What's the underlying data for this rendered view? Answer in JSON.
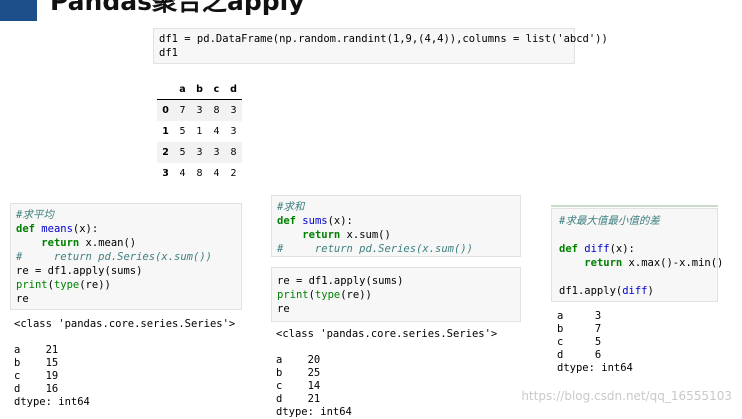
{
  "slide": {
    "title": "Pandas聚合之apply",
    "watermark": "https://blog.csdn.net/qq_16555103"
  },
  "top_cell": {
    "lines": [
      "df1 = pd.DataFrame(np.random.randint(1,9,(4,4)),columns = list('abcd'))",
      "df1"
    ]
  },
  "dataframe": {
    "columns": [
      "",
      "a",
      "b",
      "c",
      "d"
    ],
    "rows": [
      {
        "index": "0",
        "values": [
          "7",
          "3",
          "8",
          "3"
        ]
      },
      {
        "index": "1",
        "values": [
          "5",
          "1",
          "4",
          "3"
        ]
      },
      {
        "index": "2",
        "values": [
          "5",
          "3",
          "3",
          "8"
        ]
      },
      {
        "index": "3",
        "values": [
          "4",
          "8",
          "4",
          "2"
        ]
      }
    ]
  },
  "mean_cell": {
    "comment": "#求平均",
    "def_kw": "def",
    "func_name": "means",
    "def_rest": "(x):",
    "return_kw": "return",
    "return_rest": " x.mean()",
    "commented_line": "#     return pd.Series(x.sum())",
    "apply_line": "re = df1.apply(sums)",
    "print_kw": "print",
    "type_kw": "type",
    "print_rest_1": "(",
    "print_rest_2": "(re))",
    "last_line": "re",
    "output": [
      "<class 'pandas.core.series.Series'>",
      "",
      "a    21",
      "b    15",
      "c    19",
      "d    16",
      "dtype: int64"
    ]
  },
  "sum_cell": {
    "comment": "#求和",
    "def_kw": "def",
    "func_name": "sums",
    "def_rest": "(x):",
    "return_kw": "return",
    "return_rest": " x.sum()",
    "commented_line": "#     return pd.Series(x.sum())"
  },
  "sum_apply_cell": {
    "apply_line": "re = df1.apply(sums)",
    "print_kw": "print",
    "type_kw": "type",
    "print_rest_1": "(",
    "print_rest_2": "(re))",
    "last_line": "re",
    "output": [
      "<class 'pandas.core.series.Series'>",
      "",
      "a    20",
      "b    25",
      "c    14",
      "d    21",
      "dtype: int64"
    ]
  },
  "diff_cell": {
    "comment": "#求最大值最小值的差",
    "def_kw": "def",
    "func_name": "diff",
    "def_rest": "(x):",
    "return_kw": "return",
    "return_rest": " x.max()-x.min()",
    "apply_line_pre": "df1.apply(",
    "apply_arg": "diff",
    "apply_line_post": ")",
    "output": [
      "a     3",
      "b     7",
      "c     5",
      "d     6",
      "dtype: int64"
    ]
  },
  "colors": {
    "accent": "#1c4f8a",
    "keyword": "#008000",
    "comment": "#408080",
    "function": "#0000cc",
    "cell_bg": "#f7f7f7"
  }
}
